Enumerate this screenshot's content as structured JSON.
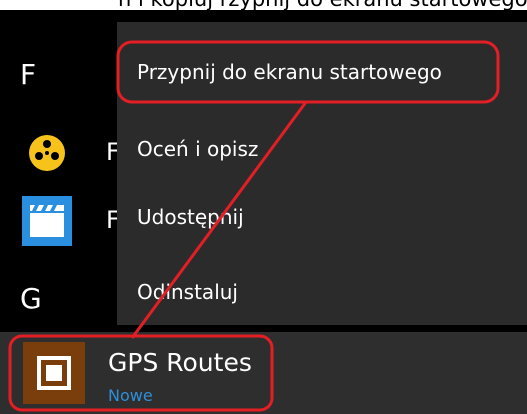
{
  "top_strip_text": "n i  kopiuj  rzypnij  do  ekranu  startowego",
  "groups": [
    {
      "letter": "F"
    },
    {
      "letter": "G"
    }
  ],
  "apps": [
    {
      "label_fragment": "F",
      "icon": "film-reel-icon"
    },
    {
      "label_fragment": "F",
      "icon": "clapperboard-icon"
    }
  ],
  "context_menu": {
    "items": [
      {
        "label": "Przypnij do ekranu startowego"
      },
      {
        "label": "Oceń i opisz"
      },
      {
        "label": "Udostępnij"
      },
      {
        "label": "Odinstaluj"
      }
    ]
  },
  "selected_app": {
    "title": "GPS Routes",
    "badge": "Nowe",
    "icon": "gps-routes-icon"
  },
  "colors": {
    "background": "#000000",
    "menu": "#2b2b2b",
    "selected_row": "#2e2e2e",
    "gps_tile": "#7a3e0c",
    "badge": "#2e8fd8",
    "annotation": "#e31e24",
    "film_icon": "#f7c31a",
    "clapper_icon": "#2b8fe0"
  }
}
